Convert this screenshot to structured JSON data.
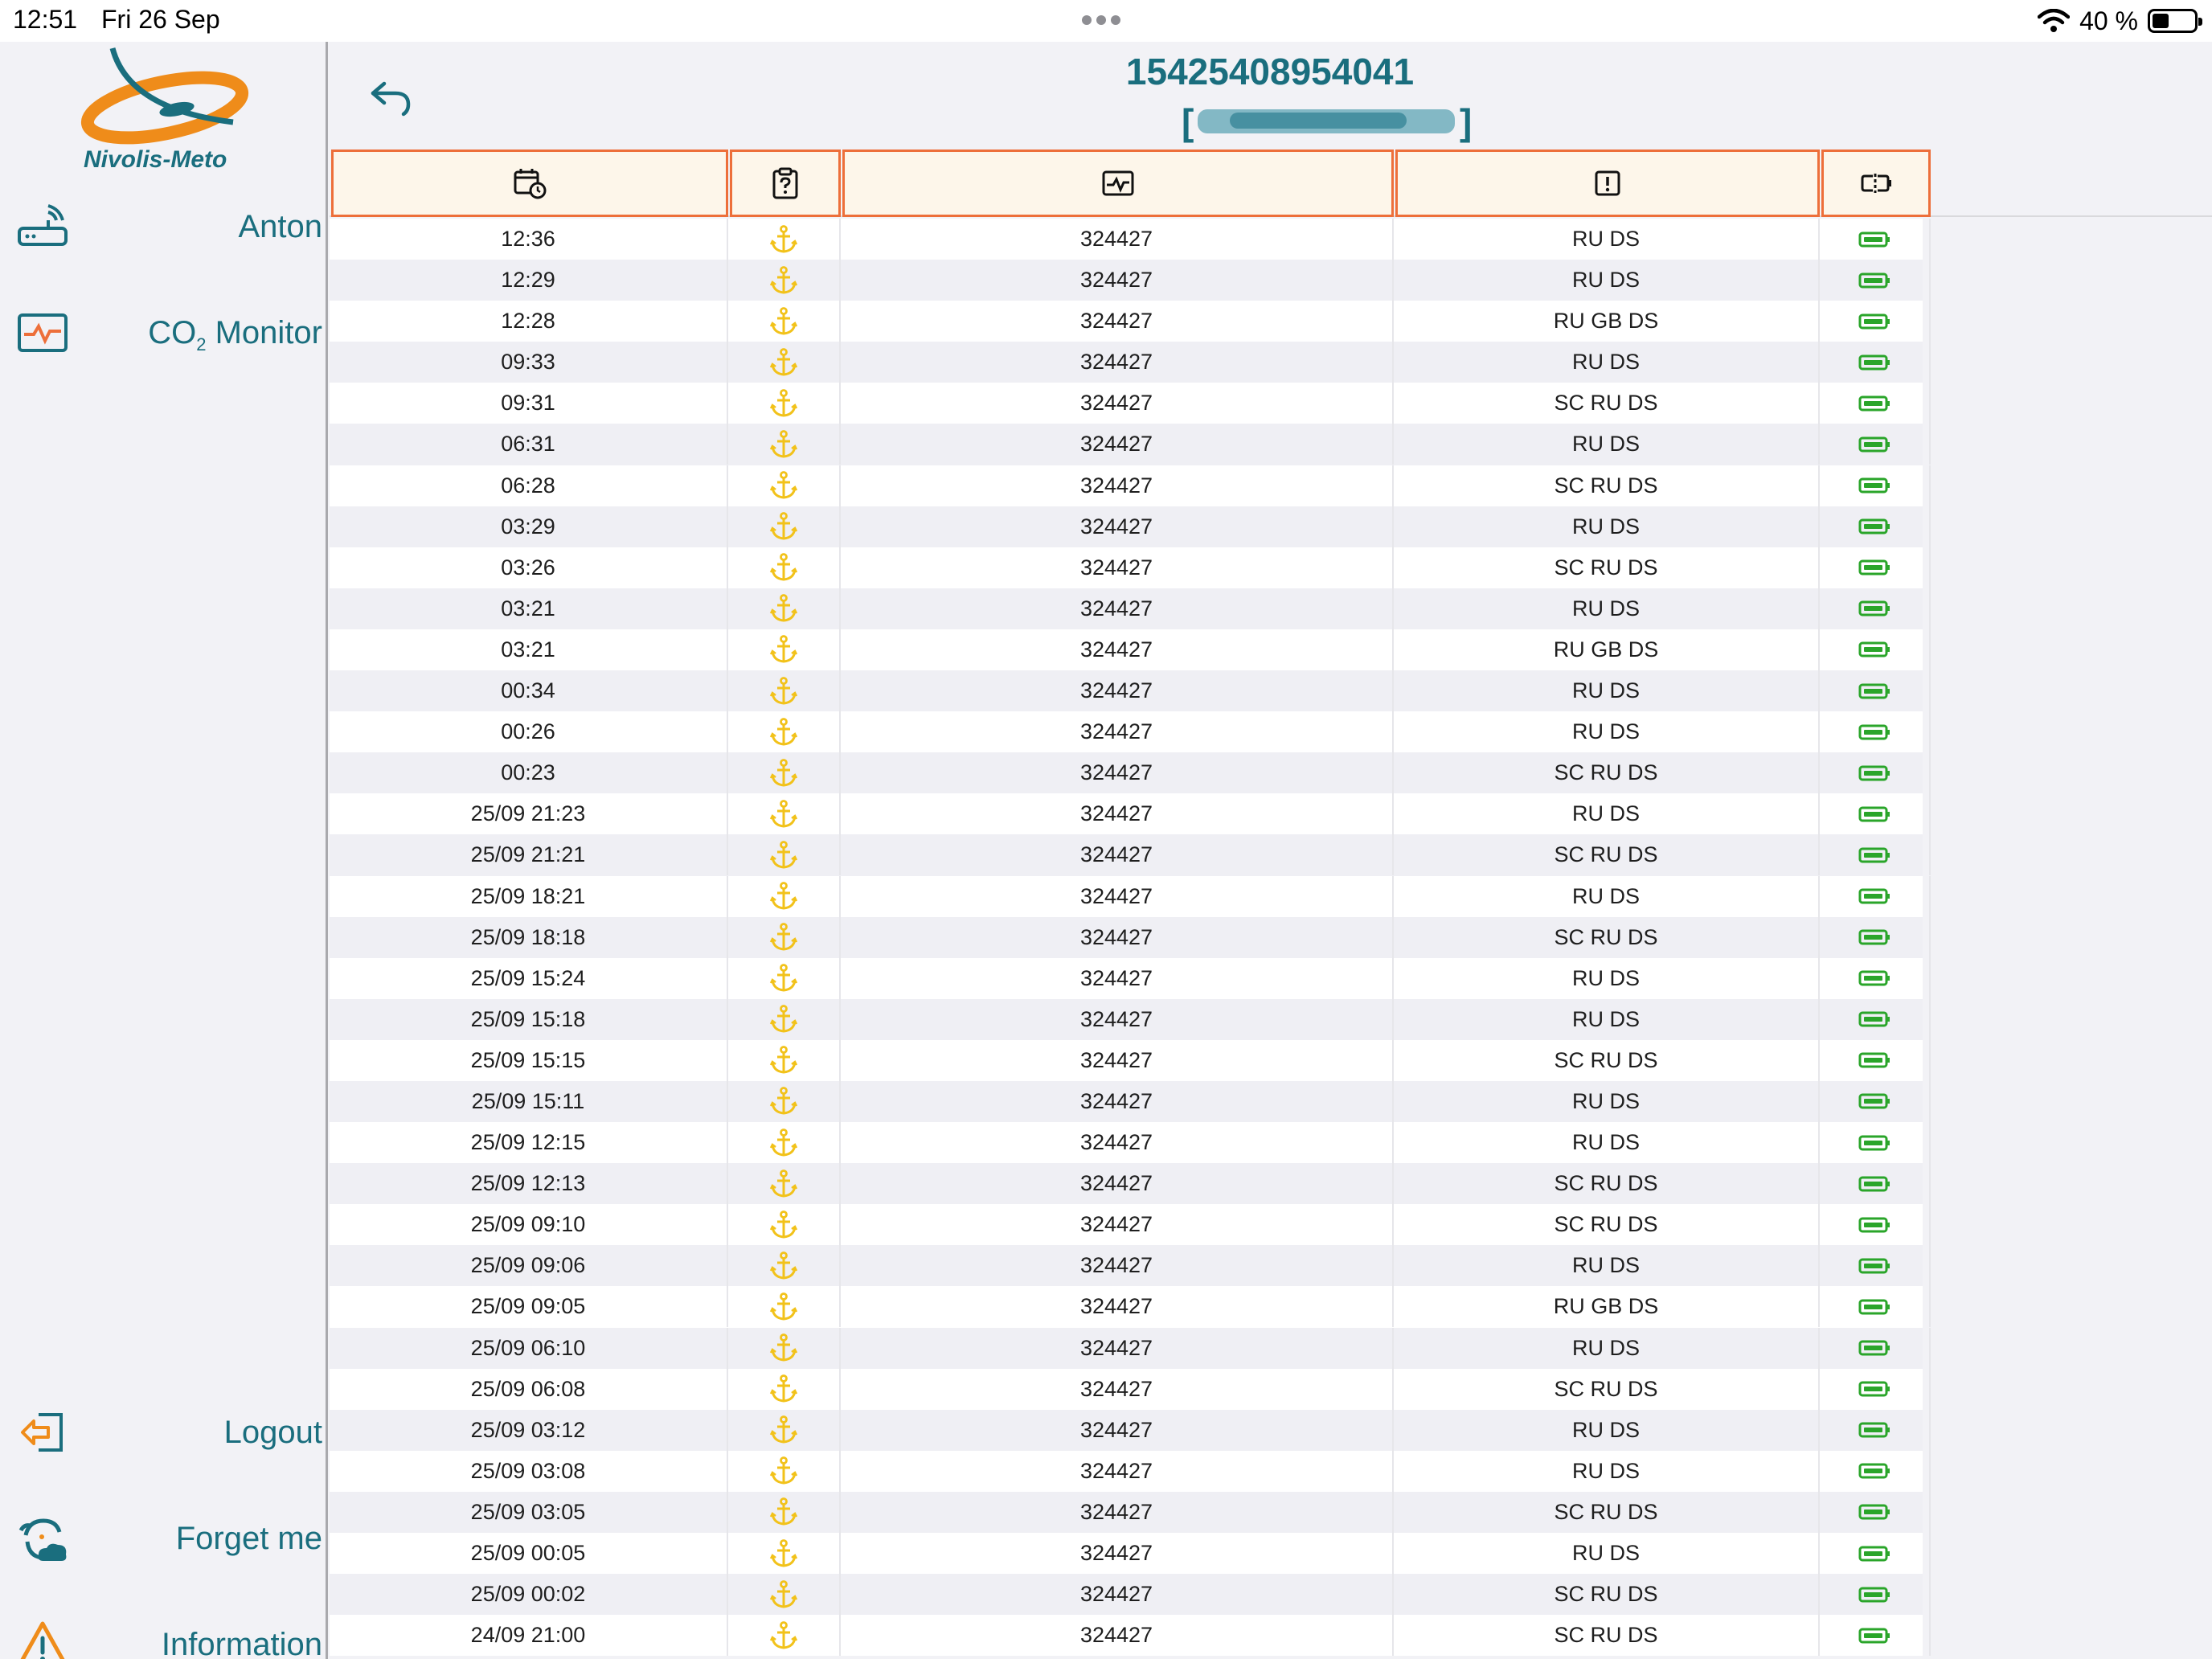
{
  "status_bar": {
    "time": "12:51",
    "date": "Fri 26 Sep",
    "battery": "40 %"
  },
  "logo": {
    "text": "Nivolis-Meto"
  },
  "sidebar": {
    "items": [
      {
        "label": "Anton",
        "icon": "router-icon"
      },
      {
        "label": "CO",
        "sub": "2",
        "label_rest": " Monitor",
        "icon": "monitor-icon"
      },
      {
        "label": "Logout",
        "icon": "logout-icon"
      },
      {
        "label": "Forget me",
        "icon": "forget-me-icon"
      },
      {
        "label": "Information",
        "icon": "warning-icon"
      }
    ]
  },
  "header": {
    "device_id": "15425408954041"
  },
  "table": {
    "columns": [
      {
        "icon": "calendar-clock-icon"
      },
      {
        "icon": "clipboard-question-icon"
      },
      {
        "icon": "pulse-icon"
      },
      {
        "icon": "alert-icon"
      },
      {
        "icon": "battery-status-icon"
      }
    ],
    "rows": [
      {
        "time": "12:36",
        "value": "324427",
        "status": "RU DS"
      },
      {
        "time": "12:29",
        "value": "324427",
        "status": "RU DS"
      },
      {
        "time": "12:28",
        "value": "324427",
        "status": "RU GB DS"
      },
      {
        "time": "09:33",
        "value": "324427",
        "status": "RU DS"
      },
      {
        "time": "09:31",
        "value": "324427",
        "status": "SC RU DS"
      },
      {
        "time": "06:31",
        "value": "324427",
        "status": "RU DS"
      },
      {
        "time": "06:28",
        "value": "324427",
        "status": "SC RU DS"
      },
      {
        "time": "03:29",
        "value": "324427",
        "status": "RU DS"
      },
      {
        "time": "03:26",
        "value": "324427",
        "status": "SC RU DS"
      },
      {
        "time": "03:21",
        "value": "324427",
        "status": "RU DS"
      },
      {
        "time": "03:21",
        "value": "324427",
        "status": "RU GB DS"
      },
      {
        "time": "00:34",
        "value": "324427",
        "status": "RU DS"
      },
      {
        "time": "00:26",
        "value": "324427",
        "status": "RU DS"
      },
      {
        "time": "00:23",
        "value": "324427",
        "status": "SC RU DS"
      },
      {
        "time": "25/09 21:23",
        "value": "324427",
        "status": "RU DS"
      },
      {
        "time": "25/09 21:21",
        "value": "324427",
        "status": "SC RU DS"
      },
      {
        "time": "25/09 18:21",
        "value": "324427",
        "status": "RU DS"
      },
      {
        "time": "25/09 18:18",
        "value": "324427",
        "status": "SC RU DS"
      },
      {
        "time": "25/09 15:24",
        "value": "324427",
        "status": "RU DS"
      },
      {
        "time": "25/09 15:18",
        "value": "324427",
        "status": "RU DS"
      },
      {
        "time": "25/09 15:15",
        "value": "324427",
        "status": "SC RU DS"
      },
      {
        "time": "25/09 15:11",
        "value": "324427",
        "status": "RU DS"
      },
      {
        "time": "25/09 12:15",
        "value": "324427",
        "status": "RU DS"
      },
      {
        "time": "25/09 12:13",
        "value": "324427",
        "status": "SC RU DS"
      },
      {
        "time": "25/09 09:10",
        "value": "324427",
        "status": "SC RU DS"
      },
      {
        "time": "25/09 09:06",
        "value": "324427",
        "status": "RU DS"
      },
      {
        "time": "25/09 09:05",
        "value": "324427",
        "status": "RU GB DS"
      },
      {
        "time": "25/09 06:10",
        "value": "324427",
        "status": "RU DS"
      },
      {
        "time": "25/09 06:08",
        "value": "324427",
        "status": "SC RU DS"
      },
      {
        "time": "25/09 03:12",
        "value": "324427",
        "status": "RU DS"
      },
      {
        "time": "25/09 03:08",
        "value": "324427",
        "status": "RU DS"
      },
      {
        "time": "25/09 03:05",
        "value": "324427",
        "status": "SC RU DS"
      },
      {
        "time": "25/09 00:05",
        "value": "324427",
        "status": "RU DS"
      },
      {
        "time": "25/09 00:02",
        "value": "324427",
        "status": "SC RU DS"
      },
      {
        "time": "24/09 21:00",
        "value": "324427",
        "status": "SC RU DS"
      }
    ]
  },
  "colors": {
    "teal": "#1a6e7e",
    "orange": "#ed6f3a",
    "anchor": "#f2c21a",
    "battery": "#2aa52a"
  }
}
